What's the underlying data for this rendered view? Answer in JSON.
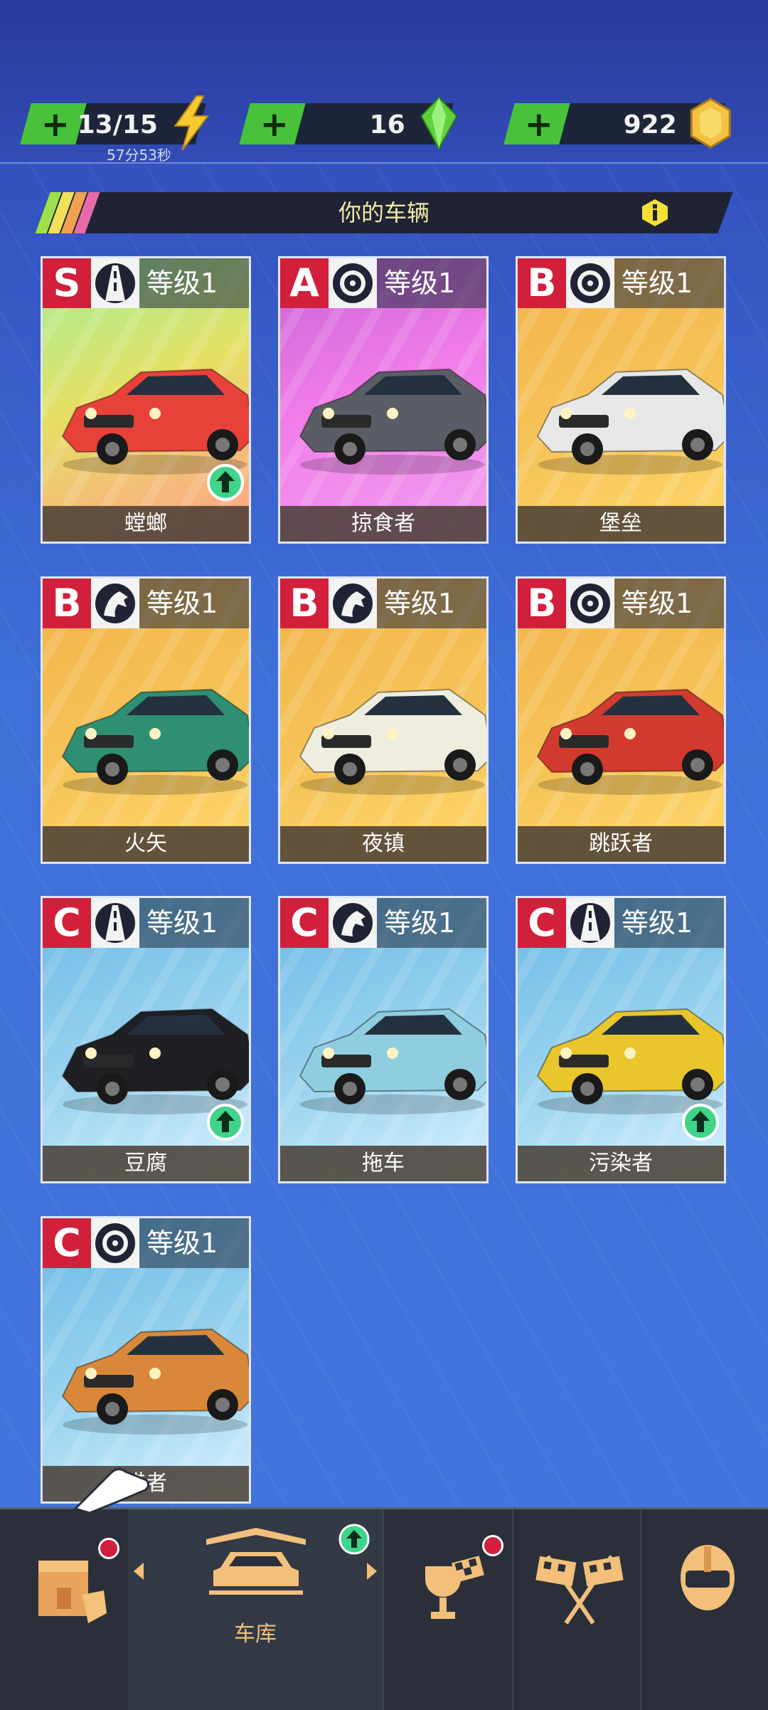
{
  "resources": {
    "energy_value": "13/15",
    "energy_timer": "57分53秒",
    "gems_value": "16",
    "coins_value": "922",
    "plus": "+"
  },
  "banner": {
    "title": "你的车辆"
  },
  "cards": [
    {
      "rank": "S",
      "type_icon": "road-icon",
      "level": "等级1",
      "name": "螳螂",
      "upgrade": true,
      "bg": "s"
    },
    {
      "rank": "A",
      "type_icon": "wheel-icon",
      "level": "等级1",
      "name": "掠食者",
      "upgrade": false,
      "bg": "a"
    },
    {
      "rank": "B",
      "type_icon": "wheel-icon",
      "level": "等级1",
      "name": "堡垒",
      "upgrade": false,
      "bg": "b"
    },
    {
      "rank": "B",
      "type_icon": "horse-icon",
      "level": "等级1",
      "name": "火矢",
      "upgrade": false,
      "bg": "b"
    },
    {
      "rank": "B",
      "type_icon": "horse-icon",
      "level": "等级1",
      "name": "夜镇",
      "upgrade": false,
      "bg": "b"
    },
    {
      "rank": "B",
      "type_icon": "wheel-icon",
      "level": "等级1",
      "name": "跳跃者",
      "upgrade": false,
      "bg": "b"
    },
    {
      "rank": "C",
      "type_icon": "road-icon",
      "level": "等级1",
      "name": "豆腐",
      "upgrade": true,
      "bg": "c"
    },
    {
      "rank": "C",
      "type_icon": "horse-icon",
      "level": "等级1",
      "name": "拖车",
      "upgrade": false,
      "bg": "c"
    },
    {
      "rank": "C",
      "type_icon": "road-icon",
      "level": "等级1",
      "name": "污染者",
      "upgrade": true,
      "bg": "c"
    },
    {
      "rank": "C",
      "type_icon": "wheel-icon",
      "level": "等级1",
      "name": "猎者",
      "upgrade": false,
      "bg": "c"
    }
  ],
  "bottom_nav": {
    "garage_label": "车库"
  },
  "colors": {
    "accent": "#47c23a",
    "rank_red": "#d11f3c",
    "nav_gold": "#f2c07a"
  }
}
